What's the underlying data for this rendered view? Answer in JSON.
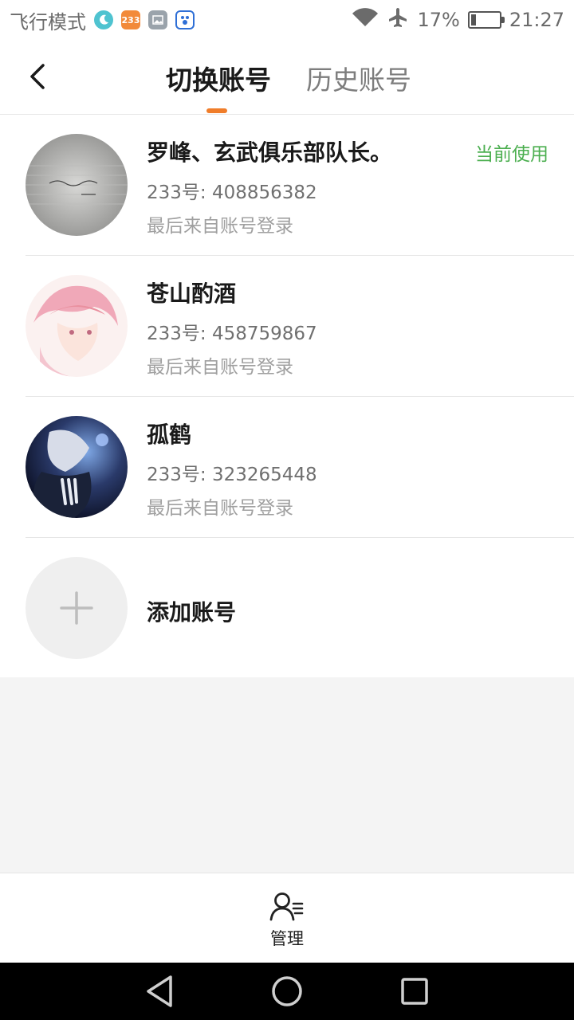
{
  "status_bar": {
    "mode_text": "飞行模式",
    "app_badge": "233",
    "battery": "17%",
    "battery_level": 0.17,
    "time": "21:27",
    "icons": [
      "moon-icon",
      "app-233-icon",
      "gallery-icon",
      "baidu-icon",
      "wifi-icon",
      "airplane-icon",
      "battery-icon"
    ]
  },
  "header": {
    "tabs": [
      {
        "label": "切换账号",
        "active": true
      },
      {
        "label": "历史账号",
        "active": false
      }
    ],
    "accent_color": "#f07d2a"
  },
  "accounts": [
    {
      "name": "罗峰、玄武俱乐部队长。",
      "uid": "233号: 408856382",
      "last_login": "最后来自账号登录",
      "status": "当前使用"
    },
    {
      "name": "苍山酌酒",
      "uid": "233号: 458759867",
      "last_login": "最后来自账号登录",
      "status": ""
    },
    {
      "name": "孤鹤",
      "uid": "233号: 323265448",
      "last_login": "最后来自账号登录",
      "status": ""
    }
  ],
  "add_account": {
    "label": "添加账号"
  },
  "bottom": {
    "manage_label": "管理"
  },
  "colors": {
    "current_status": "#4caf50"
  }
}
